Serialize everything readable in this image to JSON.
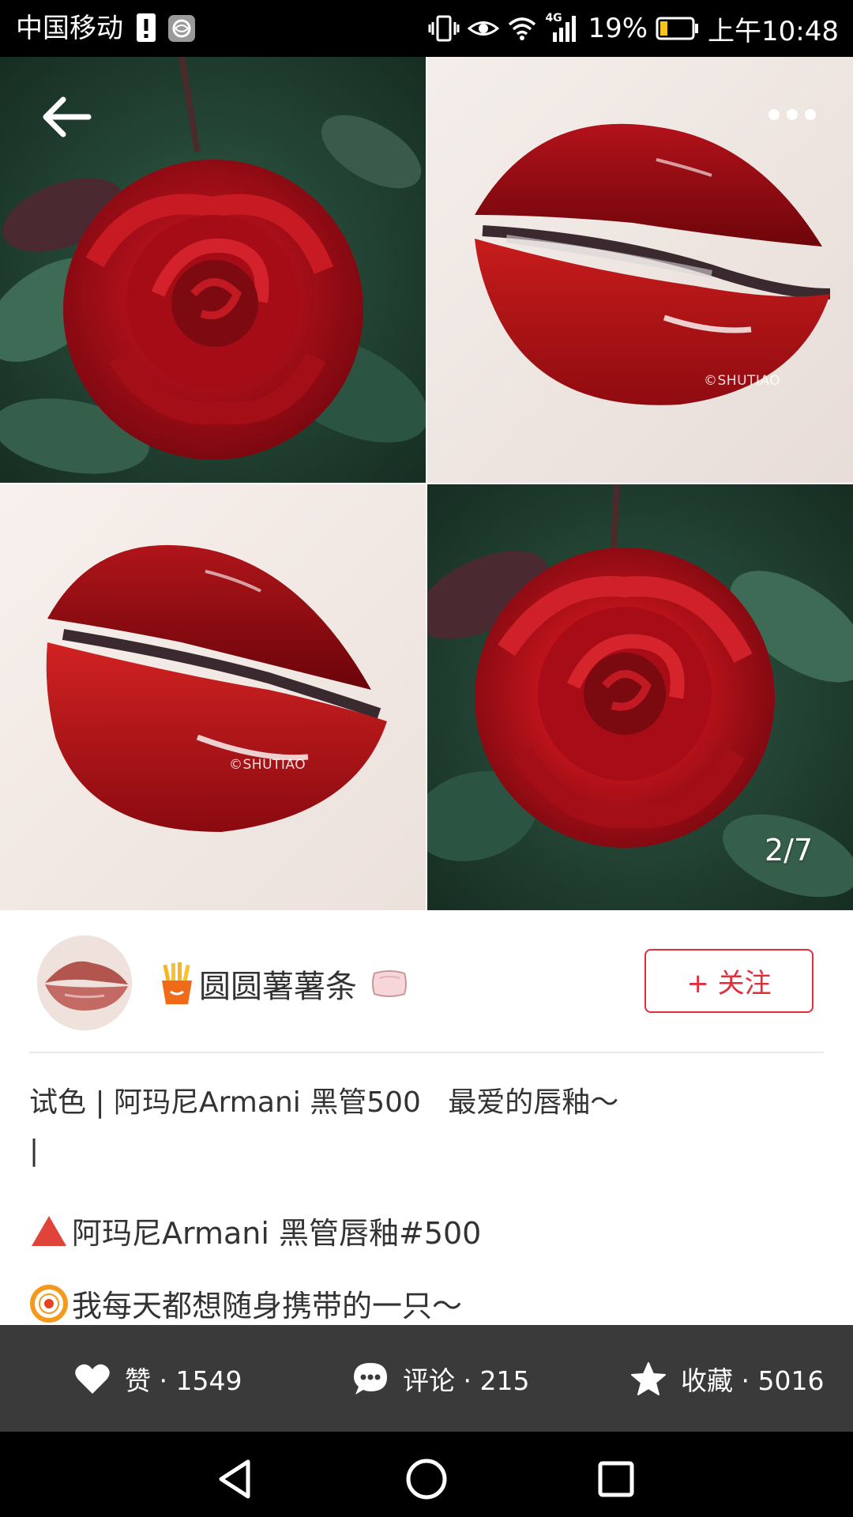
{
  "status_bar": {
    "carrier": "中国移动",
    "network": "4G",
    "battery": "19%",
    "time": "上午10:48"
  },
  "gallery": {
    "page_indicator": "2/7",
    "watermark": "©SHUTIAO"
  },
  "author": {
    "name": "圆圆薯薯条",
    "follow_label": "+ 关注"
  },
  "post": {
    "title": "试色 | 阿玛尼Armani 黑管500   最爱的唇釉～",
    "cursor": "|",
    "line1": "阿玛尼Armani 黑管唇釉#500",
    "line2": "我每天都想随身携带的一只～"
  },
  "actions": {
    "like": "赞 · 1549",
    "comment": "评论 · 215",
    "favorite": "收藏 · 5016"
  },
  "colors": {
    "accent": "#e02e3b",
    "action_bar": "#3a3a3a"
  }
}
